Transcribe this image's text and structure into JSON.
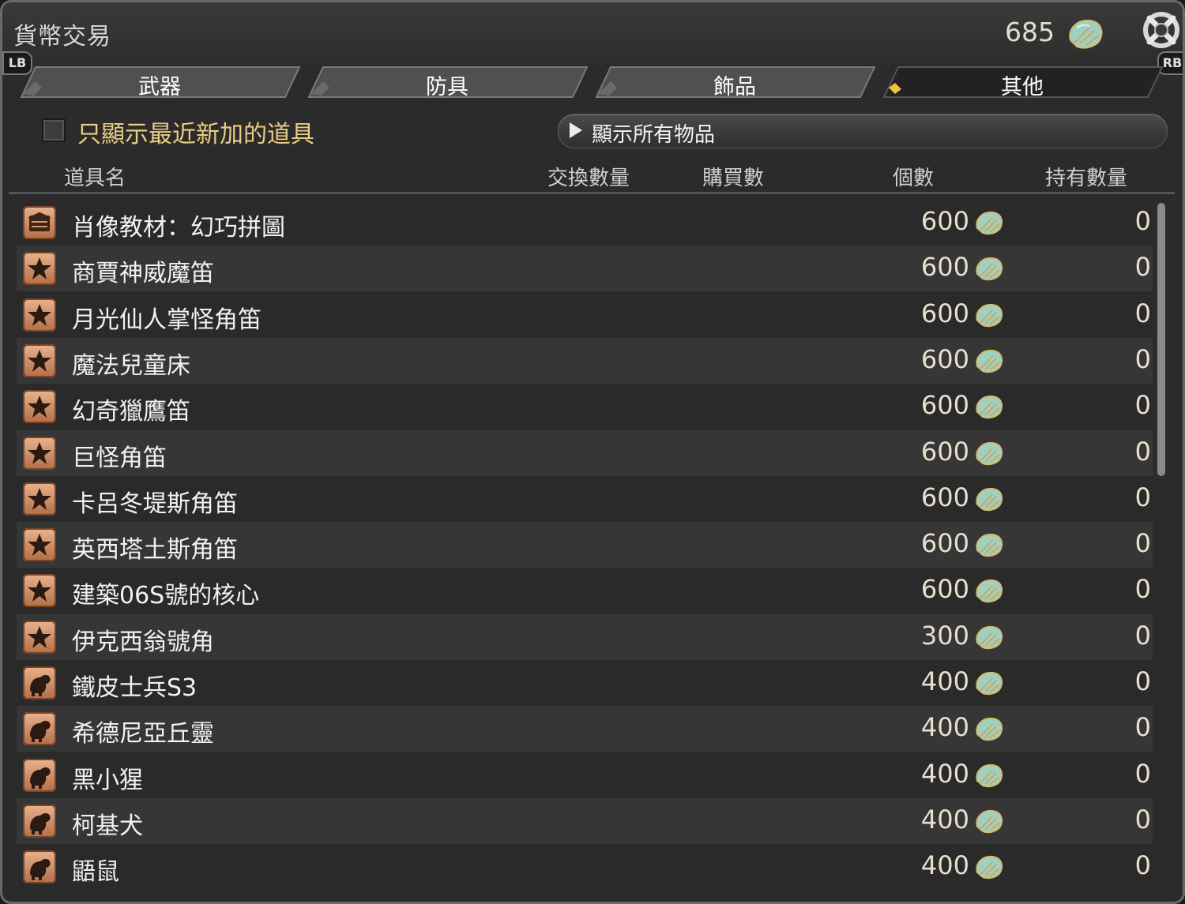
{
  "window": {
    "title": "貨幣交易"
  },
  "currency": {
    "amount": "685",
    "icon": "leaf-coin-icon"
  },
  "shoulder_buttons": {
    "left": "LB",
    "right": "RB"
  },
  "tabs": [
    {
      "label": "武器",
      "selected": false
    },
    {
      "label": "防具",
      "selected": false
    },
    {
      "label": "飾品",
      "selected": false
    },
    {
      "label": "其他",
      "selected": true
    }
  ],
  "filter": {
    "checkbox_label": "只顯示最近新加的道具",
    "checked": false,
    "dropdown_label": "顯示所有物品"
  },
  "columns": {
    "name": "道具名",
    "exchange_qty": "交換數量",
    "purchase_qty": "購買數",
    "count": "個數",
    "held": "持有數量"
  },
  "items": [
    {
      "name": "肖像教材：幻巧拼圖",
      "price": "600",
      "held": "0",
      "icon": "portrait-material-icon"
    },
    {
      "name": "商賈神威魔笛",
      "price": "600",
      "held": "0",
      "icon": "mount-star-icon"
    },
    {
      "name": "月光仙人掌怪角笛",
      "price": "600",
      "held": "0",
      "icon": "mount-star-icon"
    },
    {
      "name": "魔法兒童床",
      "price": "600",
      "held": "0",
      "icon": "mount-star-icon"
    },
    {
      "name": "幻奇獵鷹笛",
      "price": "600",
      "held": "0",
      "icon": "mount-star-icon"
    },
    {
      "name": "巨怪角笛",
      "price": "600",
      "held": "0",
      "icon": "mount-star-icon"
    },
    {
      "name": "卡呂冬堤斯角笛",
      "price": "600",
      "held": "0",
      "icon": "mount-star-icon"
    },
    {
      "name": "英西塔土斯角笛",
      "price": "600",
      "held": "0",
      "icon": "mount-star-icon"
    },
    {
      "name": "建築06S號的核心",
      "price": "600",
      "held": "0",
      "icon": "mount-star-icon"
    },
    {
      "name": "伊克西翁號角",
      "price": "300",
      "held": "0",
      "icon": "mount-star-icon"
    },
    {
      "name": "鐵皮士兵S3",
      "price": "400",
      "held": "0",
      "icon": "minion-icon"
    },
    {
      "name": "希德尼亞丘靈",
      "price": "400",
      "held": "0",
      "icon": "minion-icon"
    },
    {
      "name": "黑小猩",
      "price": "400",
      "held": "0",
      "icon": "minion-icon"
    },
    {
      "name": "柯基犬",
      "price": "400",
      "held": "0",
      "icon": "minion-icon"
    },
    {
      "name": "鼯鼠",
      "price": "400",
      "held": "0",
      "icon": "minion-icon"
    }
  ],
  "colors": {
    "accent_gold": "#e8cd84",
    "coin_teal": "#8fc3b8",
    "icon_orange": "#d9956a"
  }
}
